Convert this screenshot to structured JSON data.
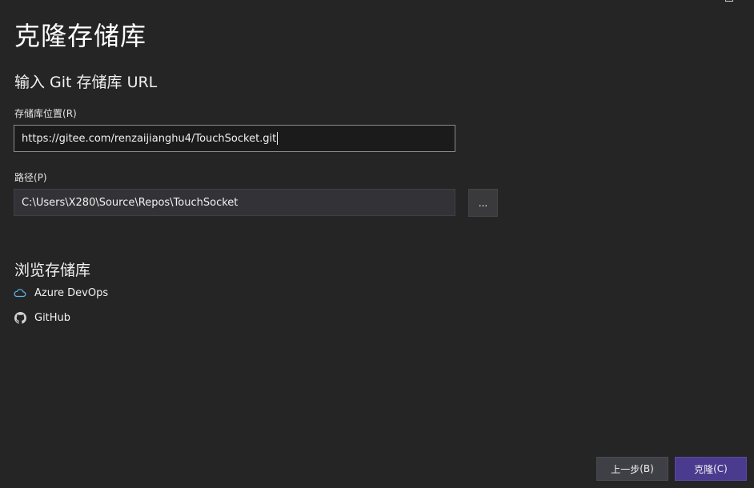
{
  "window": {
    "title": "克隆存储库"
  },
  "header": {
    "subtitle": "输入 Git 存储库 URL"
  },
  "repo_location": {
    "label": "存储库位置",
    "access_key": "(R)",
    "value": "https://gitee.com/renzaijianghu4/TouchSocket.git"
  },
  "path": {
    "label": "路径",
    "access_key": "(P)",
    "value": "C:\\Users\\X280\\Source\\Repos\\TouchSocket",
    "browse_label": "..."
  },
  "browse": {
    "title": "浏览存储库",
    "items": [
      {
        "label": "Azure DevOps",
        "icon": "cloud-icon",
        "color": "#5cb8f0"
      },
      {
        "label": "GitHub",
        "icon": "github-icon",
        "color": "#d4d4d4"
      }
    ]
  },
  "footer": {
    "back_label": "上一步",
    "back_key": "(B)",
    "clone_label": "克隆",
    "clone_key": "(C)"
  },
  "colors": {
    "background": "#252526",
    "accent": "#4b3b8f"
  }
}
